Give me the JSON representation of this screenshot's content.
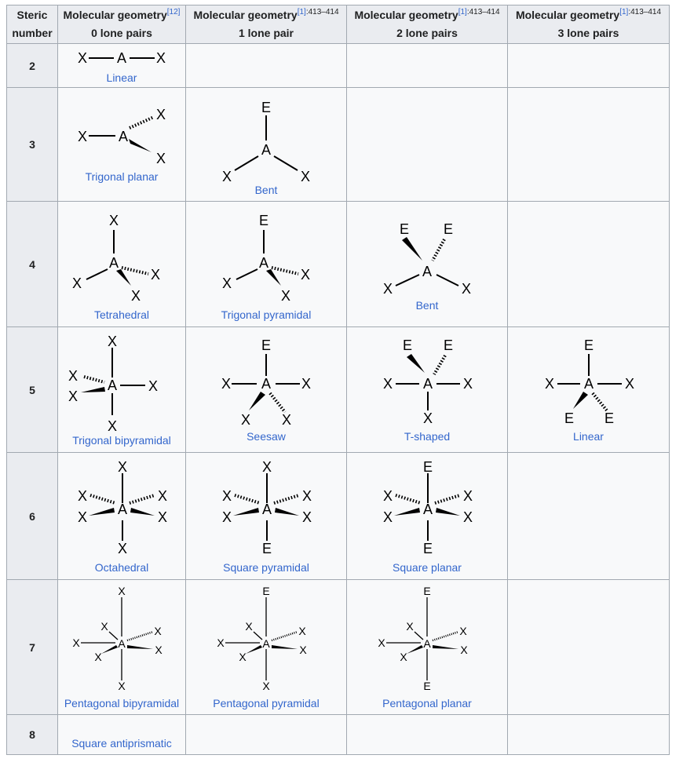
{
  "header": {
    "steric_line1": "Steric",
    "steric_line2": "number",
    "geometry_title": "Molecular geometry",
    "col0_ref": "[12]",
    "col0_sub": "0 lone pairs",
    "col1_ref": "[1]",
    "col1_pages": ":413–414",
    "col1_sub": "1 lone pair",
    "col2_ref": "[1]",
    "col2_pages": ":413–414",
    "col2_sub": "2 lone pairs",
    "col3_ref": "[1]",
    "col3_pages": ":413–414",
    "col3_sub": "3 lone pairs"
  },
  "atoms": {
    "central": "A",
    "ligand": "X",
    "lone_pair": "E"
  },
  "rows": [
    {
      "steric": "2",
      "names": [
        "Linear",
        "",
        "",
        ""
      ]
    },
    {
      "steric": "3",
      "names": [
        "Trigonal planar",
        "Bent",
        "",
        ""
      ]
    },
    {
      "steric": "4",
      "names": [
        "Tetrahedral",
        "Trigonal pyramidal",
        "Bent",
        ""
      ]
    },
    {
      "steric": "5",
      "names": [
        "Trigonal bipyramidal",
        "Seesaw",
        "T-shaped",
        "Linear"
      ]
    },
    {
      "steric": "6",
      "names": [
        "Octahedral",
        "Square pyramidal",
        "Square planar",
        ""
      ]
    },
    {
      "steric": "7",
      "names": [
        "Pentagonal bipyramidal",
        "Pentagonal pyramidal",
        "Pentagonal planar",
        ""
      ]
    },
    {
      "steric": "8",
      "names": [
        "Square antiprismatic",
        "",
        "",
        ""
      ]
    }
  ],
  "colors": {
    "link": "#3366cc",
    "header_bg": "#eaecf0",
    "cell_bg": "#f8f9fa",
    "border": "#a2a9b1"
  }
}
